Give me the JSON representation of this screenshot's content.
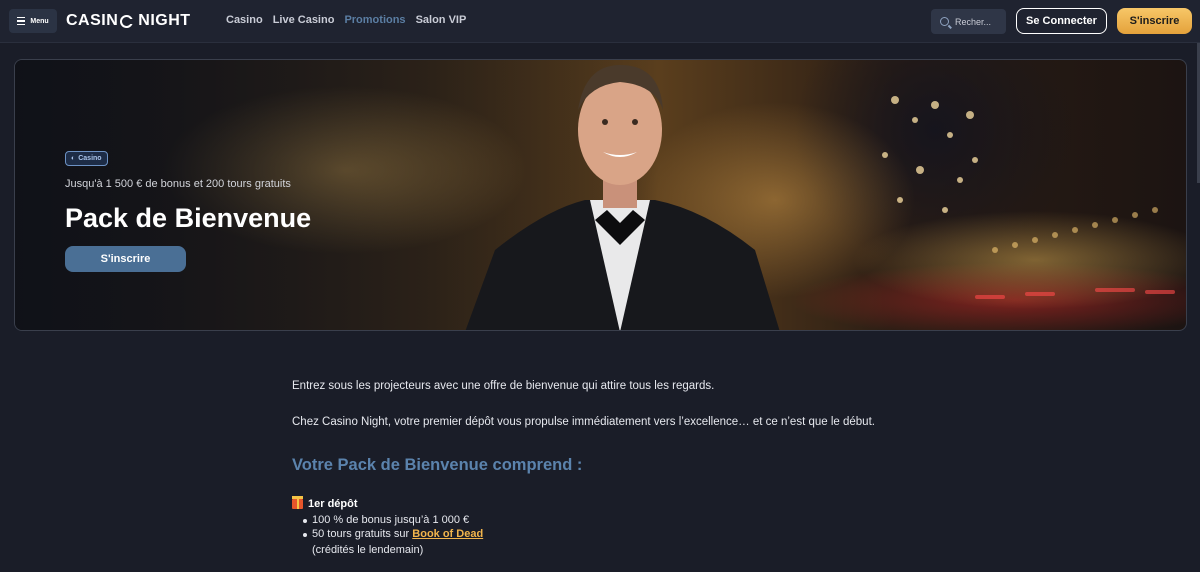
{
  "header": {
    "menu_label": "Menu",
    "logo_text": {
      "part1": "CASIN",
      "part2": "NIGHT"
    },
    "nav": [
      {
        "label": "Casino",
        "active": false
      },
      {
        "label": "Live Casino",
        "active": false
      },
      {
        "label": "Promotions",
        "active": true
      },
      {
        "label": "Salon VIP",
        "active": false
      }
    ],
    "search_placeholder": "Recher...",
    "login_label": "Se Connecter",
    "signup_label": "S'inscrire"
  },
  "hero": {
    "badge": "Casino",
    "subtitle": "Jusqu'à 1 500 € de bonus et 200 tours gratuits",
    "title": "Pack de Bienvenue",
    "cta": "S'inscrire"
  },
  "content": {
    "intro": "Entrez sous les projecteurs avec une offre de bienvenue qui attire tous les regards.",
    "intro2": "Chez Casino Night, votre premier dépôt vous propulse immédiatement vers l’excellence… et ce n’est que le début.",
    "section_title": "Votre Pack de Bienvenue comprend :",
    "deposit_title": "1er dépôt",
    "bullet1": "100 % de bonus jusqu’à 1 000 €",
    "bullet2_prefix": "50 tours gratuits sur ",
    "bullet2_link": "Book of Dead",
    "note": "(crédités le lendemain)"
  },
  "colors": {
    "accent_gold": "#f2b54c",
    "accent_blue": "#5b83ad",
    "background": "#1a1d28"
  }
}
